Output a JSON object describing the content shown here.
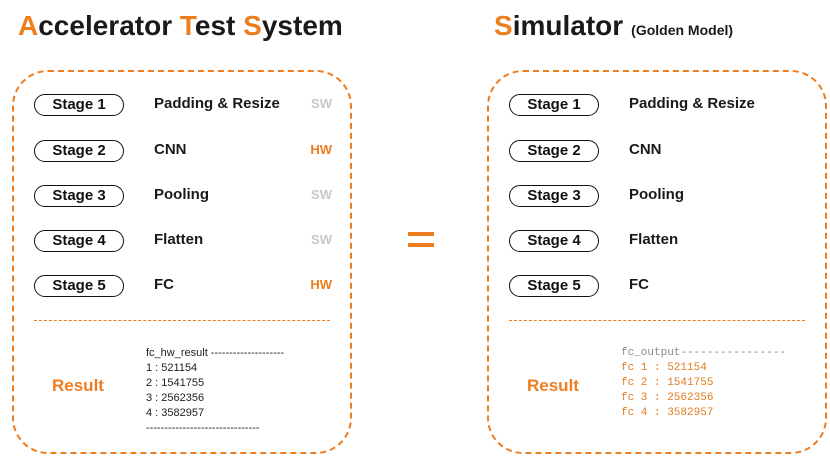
{
  "left": {
    "title": {
      "p1a": "A",
      "p1b": "ccelerator ",
      "p2a": "T",
      "p2b": "est ",
      "p3a": "S",
      "p3b": "ystem"
    },
    "stages": [
      {
        "label": "Stage 1",
        "name": "Padding & Resize",
        "tag": "SW"
      },
      {
        "label": "Stage 2",
        "name": "CNN",
        "tag": "HW"
      },
      {
        "label": "Stage 3",
        "name": "Pooling",
        "tag": "SW"
      },
      {
        "label": "Stage 4",
        "name": "Flatten",
        "tag": "SW"
      },
      {
        "label": "Stage 5",
        "name": "FC",
        "tag": "HW"
      }
    ],
    "result_label": "Result",
    "result_lines": [
      "fc_hw_result --------------------",
      "1 : 521154",
      "2 : 1541755",
      "3 : 2562356",
      "4 : 3582957",
      "-------------------------------"
    ]
  },
  "right": {
    "title": {
      "p1a": "S",
      "p1b": "imulator",
      "subtitle": "(Golden Model)"
    },
    "stages": [
      {
        "label": "Stage 1",
        "name": "Padding & Resize"
      },
      {
        "label": "Stage 2",
        "name": "CNN"
      },
      {
        "label": "Stage 3",
        "name": "Pooling"
      },
      {
        "label": "Stage 4",
        "name": "Flatten"
      },
      {
        "label": "Stage 5",
        "name": "FC"
      }
    ],
    "result_label": "Result",
    "result_lines": [
      "fc_output----------------",
      "fc 1 : 521154",
      "fc 2 : 1541755",
      "fc 3 : 2562356",
      "fc 4 : 3582957"
    ]
  },
  "colors": {
    "accent": "#ee7d1f",
    "sw_tag": "#c8c8c8",
    "text": "#1a1a1a"
  }
}
